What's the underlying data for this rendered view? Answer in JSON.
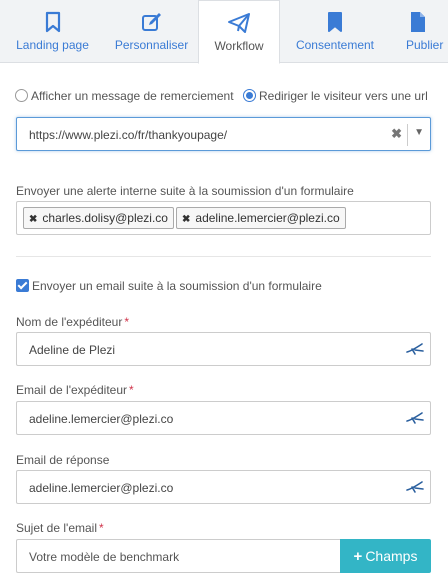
{
  "tabs": [
    {
      "label": "Landing page",
      "icon": "bookmark-icon"
    },
    {
      "label": "Personnaliser",
      "icon": "edit-icon"
    },
    {
      "label": "Workflow",
      "icon": "paper-plane-icon"
    },
    {
      "label": "Consentement",
      "icon": "bookmark-icon"
    },
    {
      "label": "Publier",
      "icon": "file-icon"
    }
  ],
  "active_tab": "Workflow",
  "redirect": {
    "option_message": "Afficher un message de remerciement",
    "option_redirect": "Rediriger le visiteur vers une url",
    "selected": "option_redirect",
    "url_value": "https://www.plezi.co/fr/thankyoupage/"
  },
  "alert": {
    "label": "Envoyer une alerte interne suite à la soumission d'un formulaire",
    "tags": [
      "charles.dolisy@plezi.co",
      "adeline.lemercier@plezi.co"
    ]
  },
  "email": {
    "checkbox_label": "Envoyer un email suite à la soumission d'un formulaire",
    "checked": true,
    "sender_name_label": "Nom de l'expéditeur",
    "sender_name_value": "Adeline de Plezi",
    "sender_email_label": "Email de l'expéditeur",
    "sender_email_value": "adeline.lemercier@plezi.co",
    "reply_label": "Email de réponse",
    "reply_value": "adeline.lemercier@plezi.co",
    "subject_label": "Sujet de l'email",
    "subject_value": "Votre modèle de benchmark",
    "champs_button": "Champs",
    "required_mark": "*"
  },
  "colors": {
    "accent": "#3a7bd5",
    "champs": "#33b5c6",
    "required": "#d0334a"
  }
}
